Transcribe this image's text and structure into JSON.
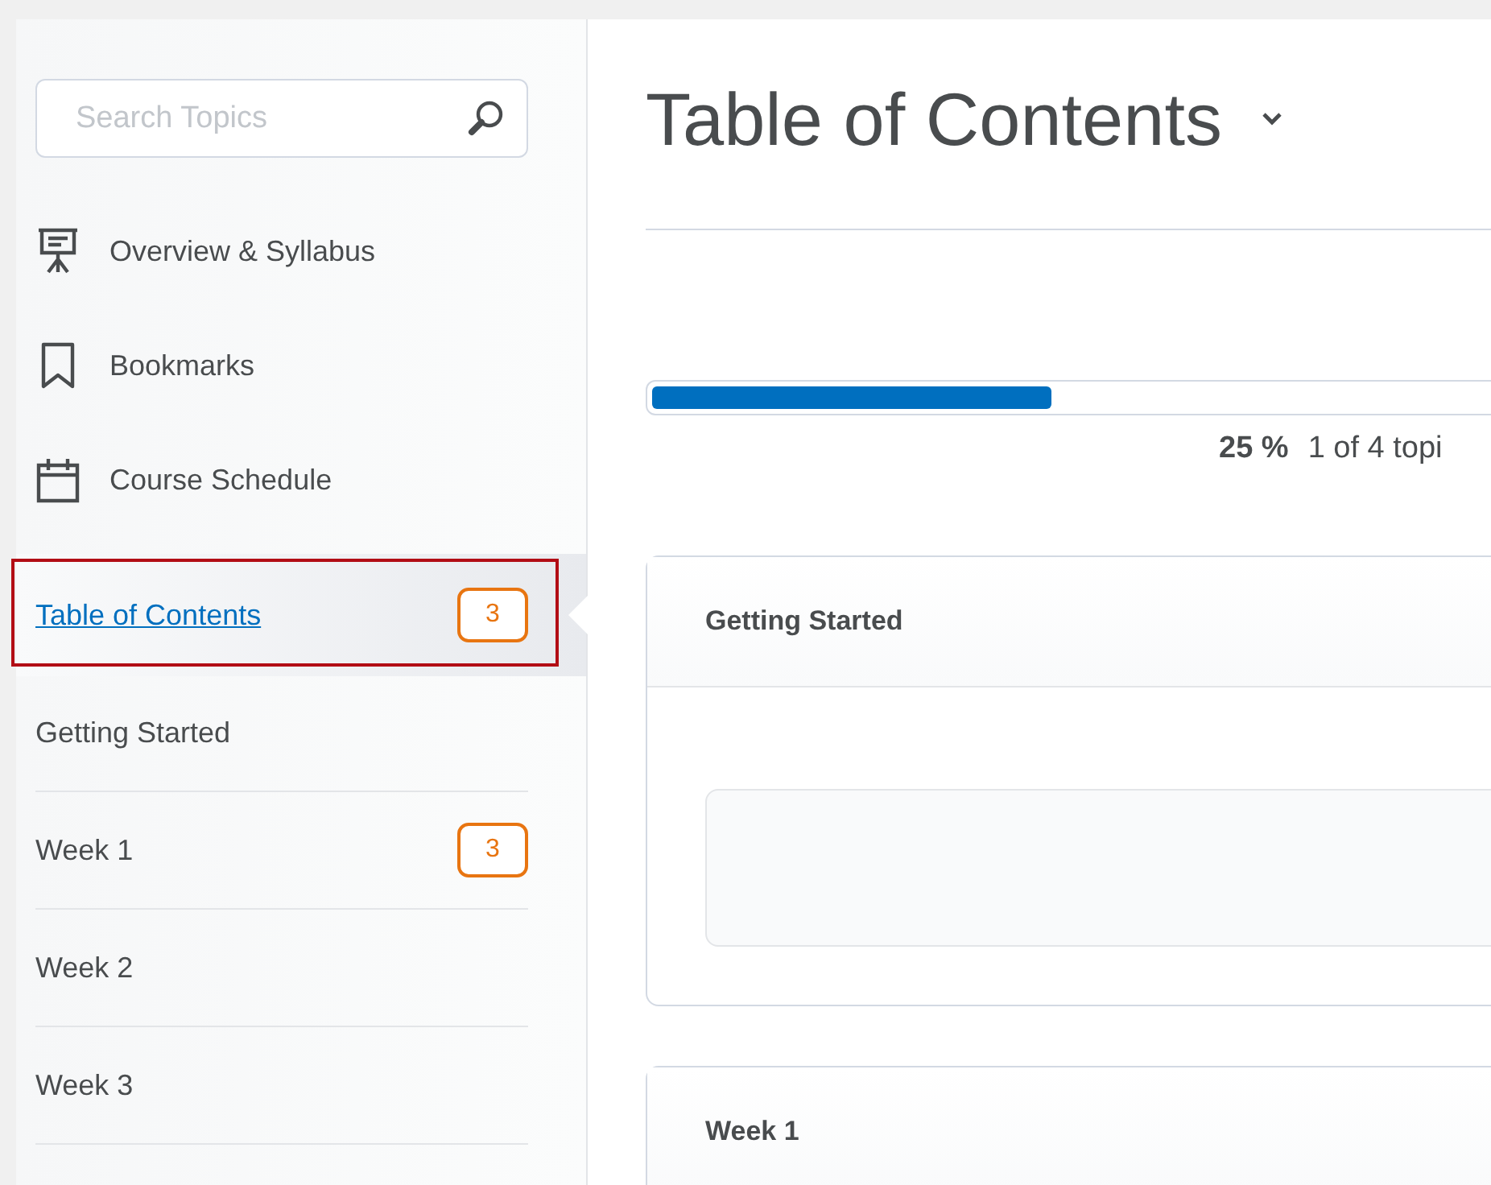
{
  "sidebar": {
    "search": {
      "placeholder": "Search Topics"
    },
    "tools": [
      {
        "kind": "presentation",
        "label": "Overview & Syllabus"
      },
      {
        "kind": "bookmark",
        "label": "Bookmarks"
      },
      {
        "kind": "calendar",
        "label": "Course Schedule"
      }
    ],
    "toc": {
      "label": "Table of Contents",
      "badge": "3",
      "selected": true,
      "highlighted": true
    },
    "units": [
      {
        "label": "Getting Started",
        "selected": false
      },
      {
        "label": "Week 1",
        "badge": "3",
        "selected": false
      },
      {
        "label": "Week 2",
        "selected": false
      },
      {
        "label": "Week 3",
        "selected": false
      }
    ]
  },
  "main": {
    "title": "Table of Contents",
    "progress": {
      "level": 0.25,
      "percent": "25 %",
      "label": "1 of 4 topi"
    },
    "sections": [
      {
        "title": "Getting Started",
        "kind": "with-panel"
      },
      {
        "title": "Week 1",
        "kind": "header-only"
      }
    ]
  }
}
